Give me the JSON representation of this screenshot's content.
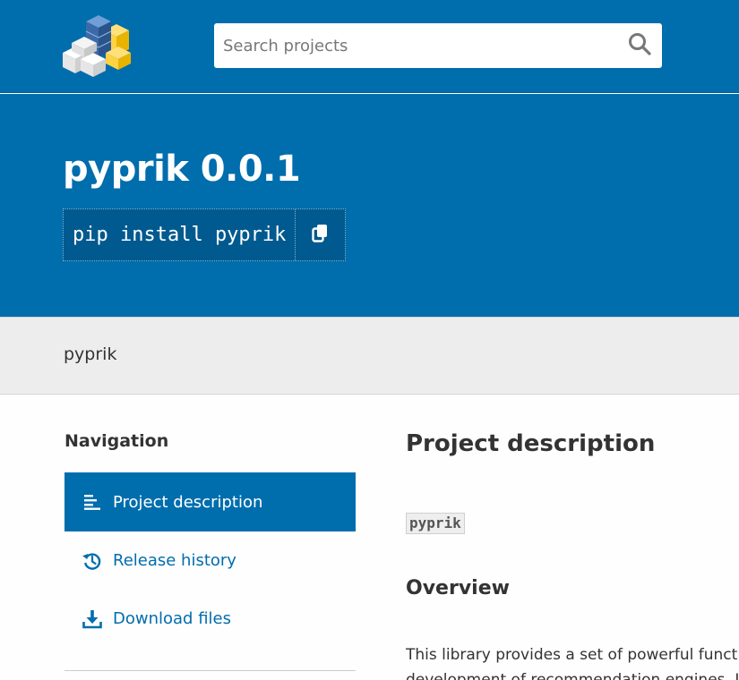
{
  "search": {
    "placeholder": "Search projects"
  },
  "icons": {
    "logo": "pypi-cubes-logo",
    "search": "search-icon",
    "copy": "copy-icon",
    "description": "align-left-icon",
    "history": "history-icon",
    "download": "download-icon"
  },
  "header": {
    "title": "pyprik 0.0.1",
    "pip_command": "pip install pyprik"
  },
  "breadcrumb": {
    "current": "pyprik"
  },
  "navigation": {
    "heading": "Navigation",
    "items": [
      {
        "label": "Project description",
        "active": true
      },
      {
        "label": "Release history",
        "active": false
      },
      {
        "label": "Download files",
        "active": false
      }
    ]
  },
  "main": {
    "heading": "Project description",
    "code_label": "pyprik",
    "overview_heading": "Overview",
    "paragraph_lines": [
      "This library provides a set of powerful functio",
      "development of recommendation engines. It"
    ]
  },
  "colors": {
    "brand_blue": "#006dad",
    "crumb_bg": "#ededed"
  }
}
